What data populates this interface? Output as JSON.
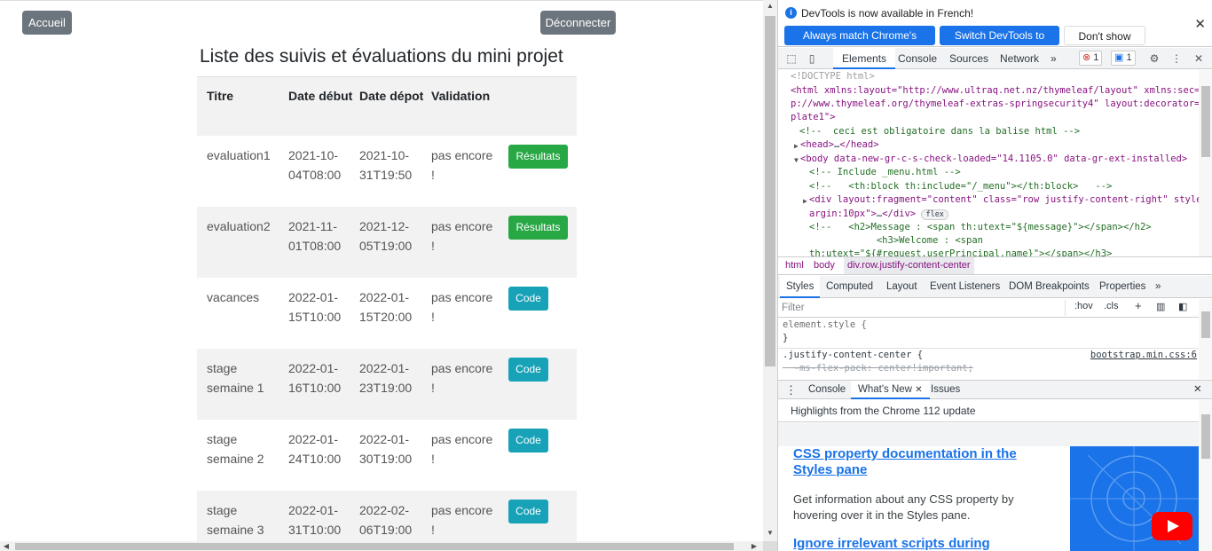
{
  "page": {
    "home_button": "Accueil",
    "logout_button": "Déconnecter",
    "title": "Liste des suivis et évaluations du mini projet",
    "columns": [
      "Titre",
      "Date début",
      "Date dépot",
      "Validation"
    ],
    "rows": [
      {
        "title": "evaluation1",
        "start": "2021-10-04T08:00",
        "end": "2021-10-31T19:50",
        "validation": "pas encore !",
        "action": "Résultats",
        "action_color": "#28a745"
      },
      {
        "title": "evaluation2",
        "start": "2021-11-01T08:00",
        "end": "2021-12-05T19:00",
        "validation": "pas encore !",
        "action": "Résultats",
        "action_color": "#28a745"
      },
      {
        "title": "vacances",
        "start": "2022-01-15T10:00",
        "end": "2022-01-15T20:00",
        "validation": "pas encore !",
        "action": "Code",
        "action_color": "#17a2b8"
      },
      {
        "title": "stage semaine 1",
        "start": "2022-01-16T10:00",
        "end": "2022-01-23T19:00",
        "validation": "pas encore !",
        "action": "Code",
        "action_color": "#17a2b8"
      },
      {
        "title": "stage semaine 2",
        "start": "2022-01-24T10:00",
        "end": "2022-01-30T19:00",
        "validation": "pas encore !",
        "action": "Code",
        "action_color": "#17a2b8"
      },
      {
        "title": "stage semaine 3",
        "start": "2022-01-31T10:00",
        "end": "2022-02-06T19:00",
        "validation": "pas encore !",
        "action": "Code",
        "action_color": "#17a2b8"
      }
    ]
  },
  "devtools": {
    "infobar": {
      "text": "DevTools is now available in French!",
      "btn_match": "Always match Chrome's language",
      "btn_switch": "Switch DevTools to French",
      "btn_dont": "Don't show again"
    },
    "tabs": [
      "Elements",
      "Console",
      "Sources",
      "Network"
    ],
    "more_tabs": "»",
    "errors_count": "1",
    "messages_count": "1",
    "dom": {
      "l1": "<!DOCTYPE html>",
      "l2": "<html xmlns:layout=\"http://www.ultraq.net.nz/thymeleaf/layout\" xmlns:sec=\"htt",
      "l3": "p://www.thymeleaf.org/thymeleaf-extras-springsecurity4\" layout:decorator=\"tem",
      "l4": "plate1\">",
      "l5": "<!--  ceci est obligatoire dans la balise html -->",
      "l6": "<head>",
      "l6b": "…",
      "l6c": "</head>",
      "l7": "<body data-new-gr-c-s-check-loaded=\"14.1105.0\" data-gr-ext-installed>",
      "l8": "<!-- Include _menu.html -->",
      "l9": "<!--   <th:block th:include=\"/_menu\"></th:block>   -->",
      "l10": "<div layout:fragment=\"content\" class=\"row justify-content-right\" style=\"m",
      "l11": "argin:10px\">",
      "l11b": "…",
      "l11c": "</div>",
      "l11d": "flex",
      "l12": "<!--   <h2>Message : <span th:utext=\"${message}\"></span></h2>",
      "l13": "            <h3>Welcome : <span",
      "l14": "th:utext=\"${#request.userPrincipal.name}\"></span></h3>"
    },
    "breadcrumb": [
      "html",
      "body",
      "div.row.justify-content-center"
    ],
    "subtabs": [
      "Styles",
      "Computed",
      "Layout",
      "Event Listeners",
      "DOM Breakpoints",
      "Properties"
    ],
    "subtabs_more": "»",
    "filter_placeholder": "Filter",
    "filter_hov": ":hov",
    "filter_cls": ".cls",
    "styles": {
      "l1": "element.style {",
      "l2": "}",
      "l3": ".justify-content-center {",
      "l3_link": "bootstrap.min.css:6",
      "l4": "  -ms-flex-pack: center!important;"
    },
    "drawer_tabs": [
      "Console",
      "What's New",
      "Issues"
    ],
    "highlights": "Highlights from the Chrome 112 update",
    "whatsnew": {
      "h1": "CSS property documentation in the Styles pane",
      "p1": "Get information about any CSS property by hovering over it in the Styles pane.",
      "h2": "Ignore irrelevant scripts during"
    }
  }
}
